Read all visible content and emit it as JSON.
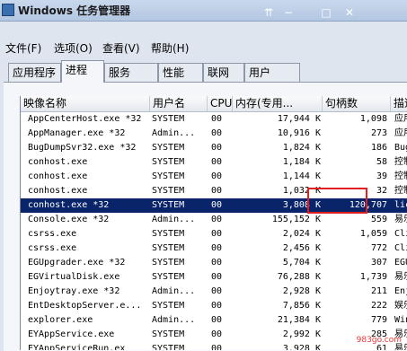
{
  "window": {
    "title": "Windows 任务管理器",
    "buttons": {
      "pin": "⇈",
      "minimize": "−",
      "maximize": "□",
      "close": "✕"
    }
  },
  "menu": {
    "items": [
      "文件(F)",
      "选项(O)",
      "查看(V)",
      "帮助(H)"
    ]
  },
  "tabs": [
    {
      "label": "应用程序"
    },
    {
      "label": "进程"
    },
    {
      "label": "服务"
    },
    {
      "label": "性能"
    },
    {
      "label": "联网"
    },
    {
      "label": "用户"
    }
  ],
  "table": {
    "columns": [
      "映像名称",
      "用户名",
      "CPU",
      "内存(专用...",
      "句柄数",
      "描述"
    ],
    "rows": [
      {
        "name": "AppCenterHost.exe *32",
        "user": "SYSTEM",
        "cpu": "00",
        "mem": "17,944 K",
        "handles": "1,098",
        "desc": "应用中"
      },
      {
        "name": "AppManager.exe *32",
        "user": "Admin...",
        "cpu": "00",
        "mem": "10,916 K",
        "handles": "273",
        "desc": "应用中"
      },
      {
        "name": "BugDumpSvr32.exe *32",
        "user": "SYSTEM",
        "cpu": "00",
        "mem": "1,824 K",
        "handles": "186",
        "desc": "BugDu"
      },
      {
        "name": "conhost.exe",
        "user": "SYSTEM",
        "cpu": "00",
        "mem": "1,184 K",
        "handles": "58",
        "desc": "控制台"
      },
      {
        "name": "conhost.exe",
        "user": "SYSTEM",
        "cpu": "00",
        "mem": "1,144 K",
        "handles": "39",
        "desc": "控制台"
      },
      {
        "name": "conhost.exe",
        "user": "SYSTEM",
        "cpu": "00",
        "mem": "1,032 K",
        "handles": "32",
        "desc": "控制台"
      },
      {
        "name": "conhost.exe *32",
        "user": "SYSTEM",
        "cpu": "00",
        "mem": "3,808 K",
        "handles": "120,707",
        "desc": "licro"
      },
      {
        "name": "Console.exe *32",
        "user": "Admin...",
        "cpu": "00",
        "mem": "155,152 K",
        "handles": "559",
        "desc": "易乐游"
      },
      {
        "name": "csrss.exe",
        "user": "SYSTEM",
        "cpu": "00",
        "mem": "2,024 K",
        "handles": "1,059",
        "desc": "Clien"
      },
      {
        "name": "csrss.exe",
        "user": "SYSTEM",
        "cpu": "00",
        "mem": "2,456 K",
        "handles": "772",
        "desc": "Clien"
      },
      {
        "name": "EGUpgrader.exe *32",
        "user": "SYSTEM",
        "cpu": "00",
        "mem": "5,704 K",
        "handles": "307",
        "desc": "EGUpg"
      },
      {
        "name": "EGVirtualDisk.exe",
        "user": "SYSTEM",
        "cpu": "00",
        "mem": "76,288 K",
        "handles": "1,739",
        "desc": "易乐游"
      },
      {
        "name": "Enjoytray.exe *32",
        "user": "Admin...",
        "cpu": "00",
        "mem": "2,928 K",
        "handles": "211",
        "desc": "Enjoy"
      },
      {
        "name": "EntDesktopServer.e...",
        "user": "SYSTEM",
        "cpu": "00",
        "mem": "7,856 K",
        "handles": "222",
        "desc": "娱乐兴"
      },
      {
        "name": "explorer.exe",
        "user": "Admin...",
        "cpu": "00",
        "mem": "21,384 K",
        "handles": "779",
        "desc": "Winds"
      },
      {
        "name": "EYAppService.exe",
        "user": "SYSTEM",
        "cpu": "00",
        "mem": "2,992 K",
        "handles": "285",
        "desc": "易乐游"
      },
      {
        "name": "EYAppServiceRun.ex",
        "user": "SYSTEM",
        "cpu": "00",
        "mem": "3,928 K",
        "handles": "61",
        "desc": "易乐游"
      }
    ],
    "selected_row": 6
  },
  "watermark": "983go.com",
  "colors": {
    "selection": "#0a246a",
    "highlight_box": "#e02020"
  }
}
